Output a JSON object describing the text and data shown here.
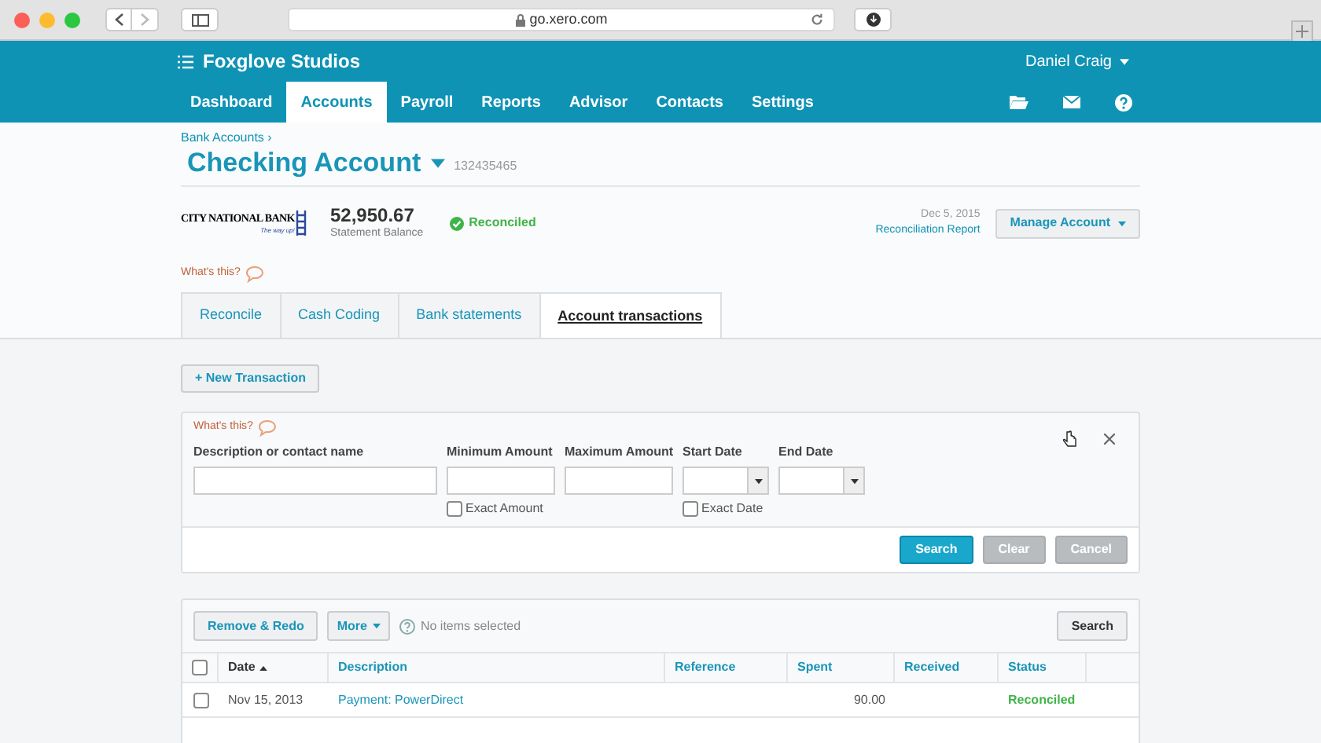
{
  "browser": {
    "url": "go.xero.com"
  },
  "header": {
    "org": "Foxglove Studios",
    "user": "Daniel Craig",
    "nav": [
      {
        "label": "Dashboard",
        "selected": false
      },
      {
        "label": "Accounts",
        "selected": true
      },
      {
        "label": "Payroll",
        "selected": false
      },
      {
        "label": "Reports",
        "selected": false
      },
      {
        "label": "Advisor",
        "selected": false
      },
      {
        "label": "Contacts",
        "selected": false
      },
      {
        "label": "Settings",
        "selected": false
      }
    ]
  },
  "breadcrumb": "Bank Accounts ›",
  "account": {
    "title": "Checking Account",
    "number": "132435465",
    "bank_name": "CITY NATIONAL BANK",
    "bank_tagline": "The way up!",
    "balance": "52,950.67",
    "balance_label": "Statement Balance",
    "status": "Reconciled",
    "date": "Dec 5, 2015",
    "report_link": "Reconciliation Report",
    "manage_button": "Manage Account"
  },
  "whats_this": "What's this?",
  "tabs": [
    {
      "label": "Reconcile",
      "selected": false
    },
    {
      "label": "Cash Coding",
      "selected": false
    },
    {
      "label": "Bank statements",
      "selected": false
    },
    {
      "label": "Account transactions",
      "selected": true
    }
  ],
  "new_transaction_button": "+ New Transaction",
  "filter": {
    "whats_this": "What's this?",
    "fields": [
      {
        "label": "Description or contact name",
        "kind": "text"
      },
      {
        "label": "Minimum Amount",
        "kind": "text",
        "checkbox": {
          "label": "Exact Amount",
          "checked": false
        }
      },
      {
        "label": "Maximum Amount",
        "kind": "text"
      },
      {
        "label": "Start Date",
        "kind": "date",
        "checkbox": {
          "label": "Exact Date",
          "checked": false
        }
      },
      {
        "label": "End Date",
        "kind": "date"
      }
    ],
    "buttons": [
      {
        "label": "Search",
        "disabled": false
      },
      {
        "label": "Clear",
        "disabled": true
      },
      {
        "label": "Cancel",
        "disabled": true
      }
    ]
  },
  "transactions": {
    "remove_button": "Remove & Redo",
    "more_button": "More",
    "selection_note": "No items selected",
    "search_button": "Search",
    "select_all_checked": false,
    "columns": [
      {
        "label": "Date",
        "sorted": true
      },
      {
        "label": "Description",
        "sorted": false
      },
      {
        "label": "Reference",
        "sorted": false
      },
      {
        "label": "Spent",
        "sorted": false
      },
      {
        "label": "Received",
        "sorted": false
      },
      {
        "label": "Status",
        "sorted": false
      }
    ],
    "rows": [
      {
        "checked": false,
        "date": "Nov 15, 2013",
        "description": "Payment: PowerDirect",
        "reference": "",
        "spent": "90.00",
        "received": "",
        "status": "Reconciled"
      }
    ]
  }
}
